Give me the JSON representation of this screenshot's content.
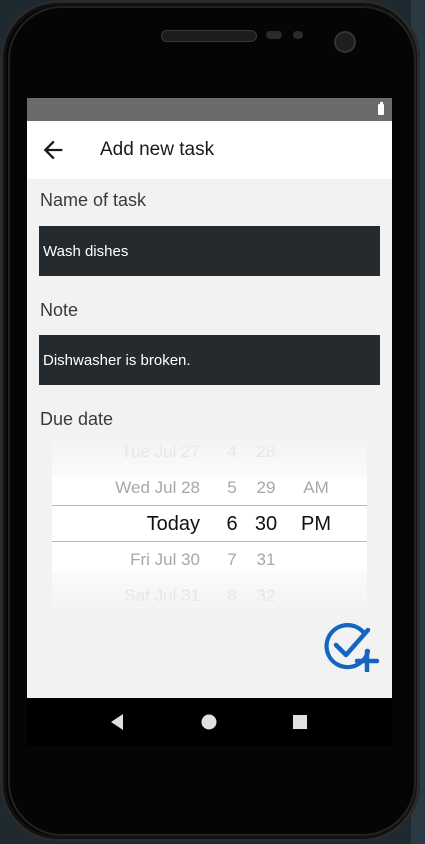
{
  "app_bar": {
    "title": "Add new task",
    "back_icon": "arrow-back-icon"
  },
  "form": {
    "name_label": "Name of task",
    "name_value": "Wash dishes",
    "note_label": "Note",
    "note_value": "Dishwasher is broken.",
    "due_label": "Due date"
  },
  "date_picker": {
    "dates": [
      "Tue Jul 27",
      "Wed Jul 28",
      "Today",
      "Fri Jul 30",
      "Sat Jul 31"
    ],
    "hours": [
      "4",
      "5",
      "6",
      "7",
      "8"
    ],
    "minutes": [
      "28",
      "29",
      "30",
      "31",
      "32"
    ],
    "ampm": [
      "",
      "AM",
      "PM",
      "",
      ""
    ],
    "selected_date": "Today",
    "selected_hour": "6",
    "selected_minute": "30",
    "selected_ampm": "PM"
  },
  "fab": {
    "icon": "add-task-icon",
    "color": "#1565c0"
  },
  "nav_bar": {
    "back_icon": "nav-back-icon",
    "home_icon": "nav-home-icon",
    "recents_icon": "nav-recents-icon"
  },
  "status_bar": {
    "battery_icon": "battery-icon",
    "color": "#6b6b6b"
  },
  "colors": {
    "field_bg": "#252a2e",
    "screen_bg": "#f2f2f2"
  }
}
